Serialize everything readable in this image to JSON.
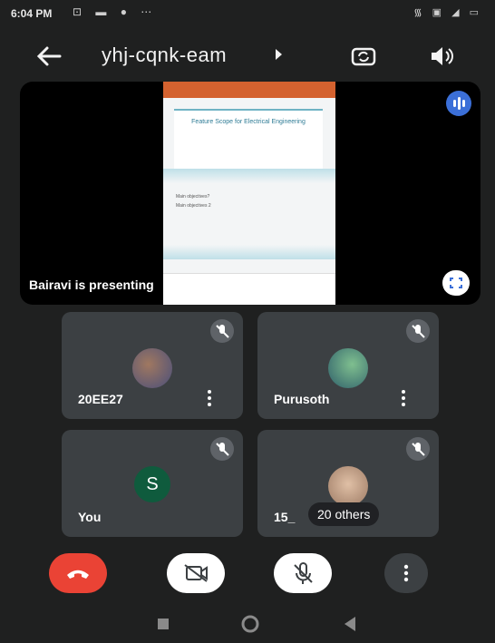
{
  "status_bar": {
    "time": "6:04 PM",
    "left_icons": "⊡ ▬ ●  ⋯",
    "right_icons": "᯾ ▣ ◢ ▭"
  },
  "header": {
    "meeting_code": "yhj-cqnk-eam"
  },
  "presentation": {
    "presenter_text": "Bairavi is presenting",
    "slide_title": "Feature Scope for Electrical Engineering",
    "slide_lines": [
      "Main objectives?",
      "Main objectives 2"
    ]
  },
  "participants": [
    {
      "name": "20EE27",
      "avatar_color": "#8d6e63"
    },
    {
      "name": "Purusoth",
      "avatar_color": "#4e8a5a"
    },
    {
      "name": "You",
      "initial": "S",
      "avatar_color": "#0f5b3d"
    },
    {
      "name": "15_",
      "others_label": "20 others",
      "avatar_color": "#c9a58c"
    }
  ],
  "controls": {
    "end_call_color": "#ea4335",
    "camera_state": "off",
    "mic_state": "muted"
  },
  "colors": {
    "background": "#1f2020",
    "tile": "#3c4043",
    "accent_blue": "#3b6fd8"
  }
}
